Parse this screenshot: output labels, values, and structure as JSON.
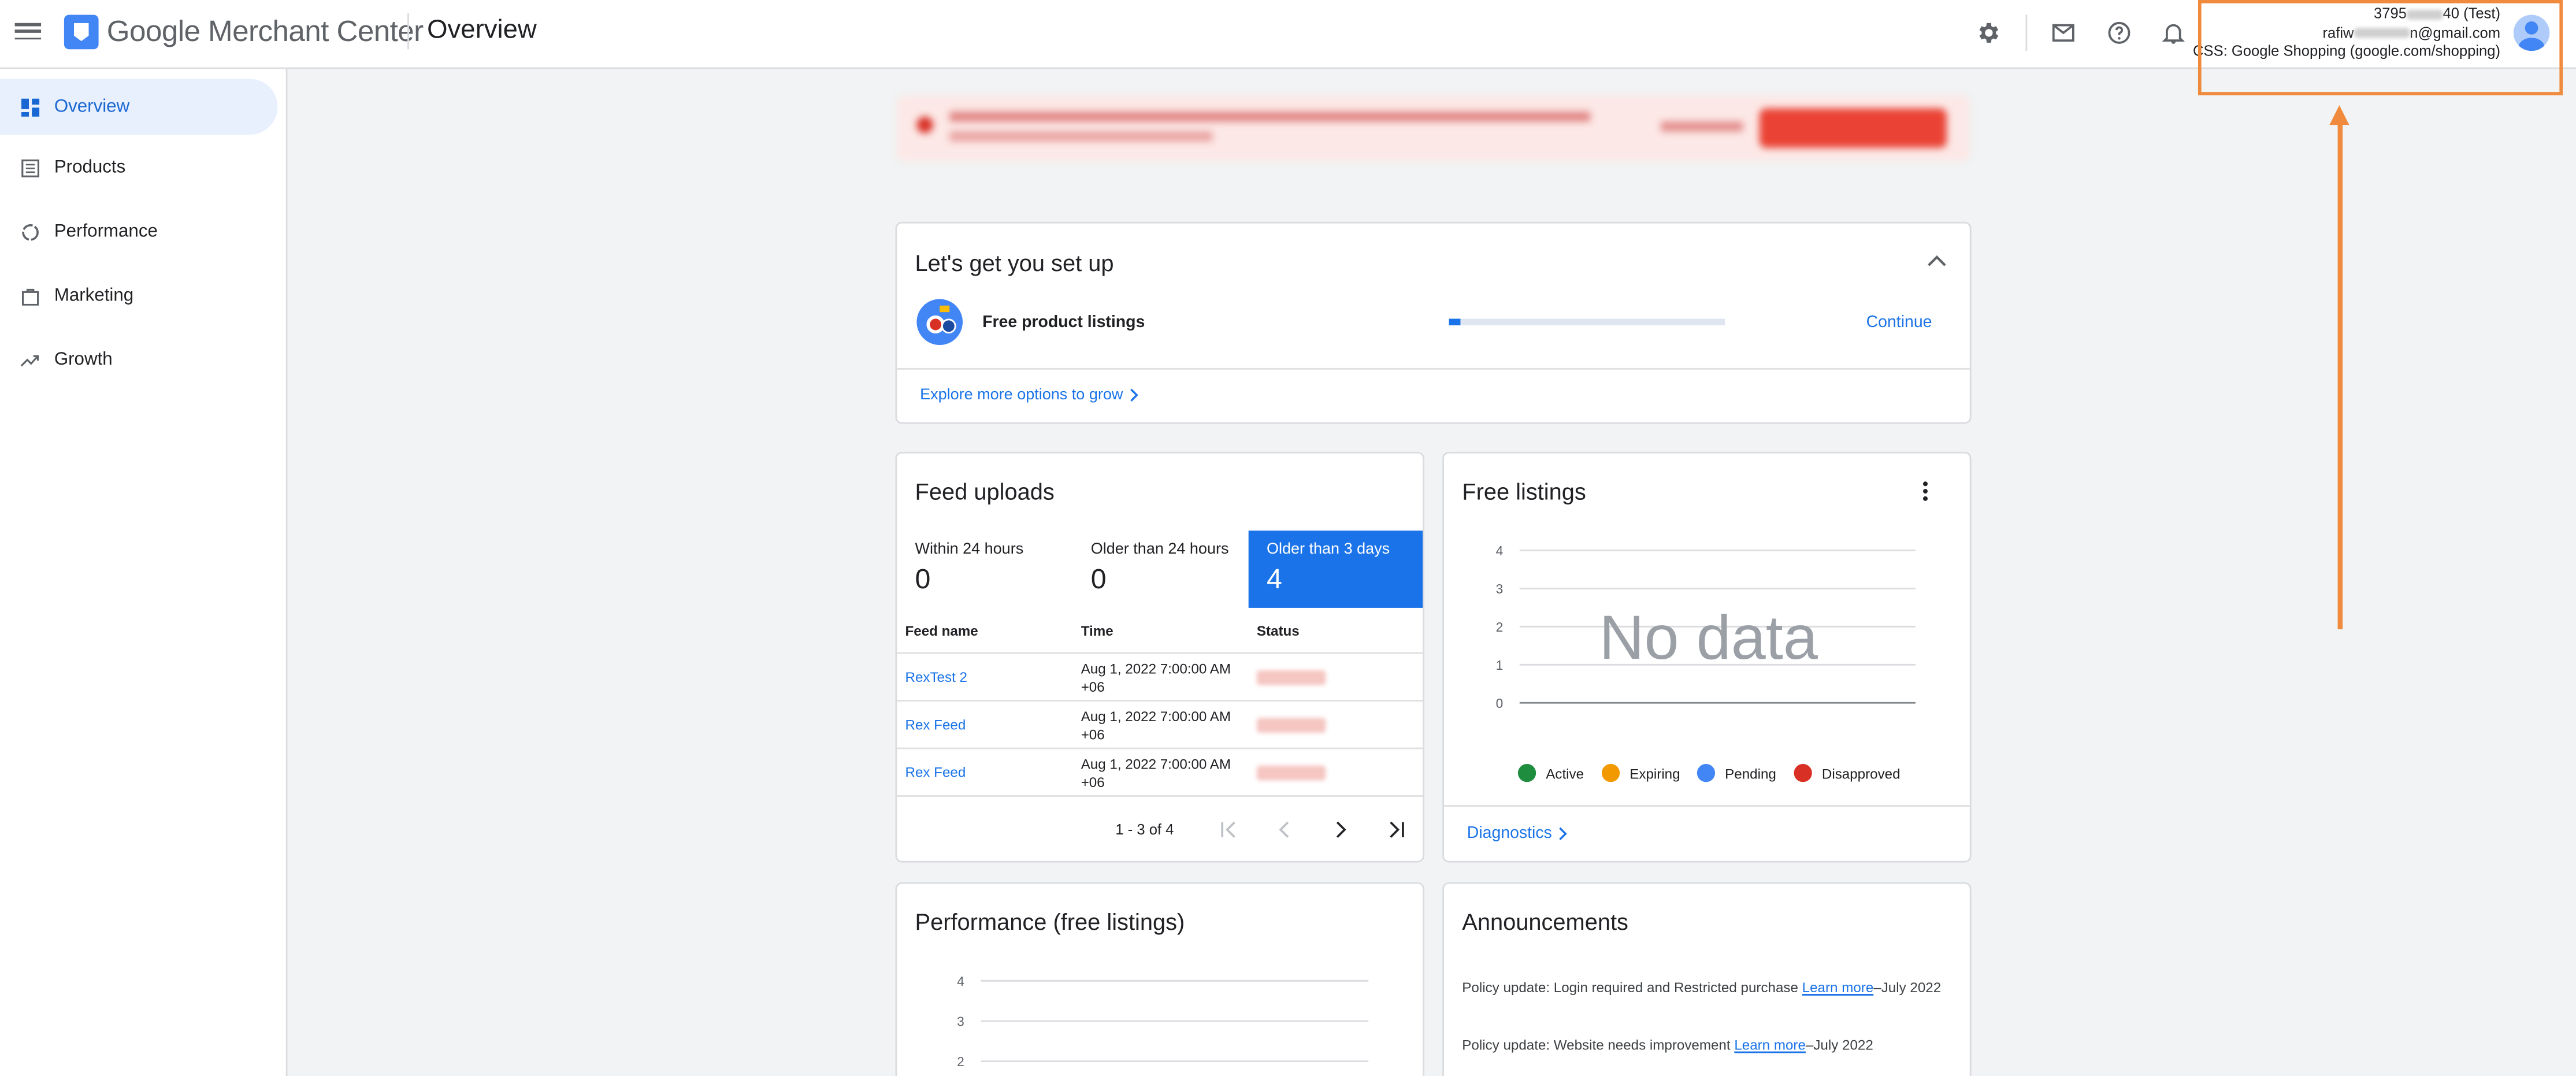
{
  "header": {
    "brand": "Google Merchant Center",
    "page_title": "Overview",
    "account": {
      "id_prefix": "3795",
      "id_suffix": "40 (Test)",
      "email_prefix": "rafiw",
      "email_suffix": "n@gmail.com",
      "css": "CSS: Google Shopping (google.com/shopping)"
    }
  },
  "sidebar": {
    "items": [
      {
        "label": "Overview",
        "icon": "dashboard-icon"
      },
      {
        "label": "Products",
        "icon": "list-icon"
      },
      {
        "label": "Performance",
        "icon": "donut-chart-icon"
      },
      {
        "label": "Marketing",
        "icon": "shopping-bag-icon"
      },
      {
        "label": "Growth",
        "icon": "trending-up-icon"
      }
    ]
  },
  "setup": {
    "title": "Let's get you set up",
    "item_label": "Free product listings",
    "progress": 0.04,
    "continue_label": "Continue",
    "explore_label": "Explore more options to grow"
  },
  "feed_uploads": {
    "title": "Feed uploads",
    "tabs": [
      {
        "label": "Within 24 hours",
        "count": "0"
      },
      {
        "label": "Older than 24 hours",
        "count": "0"
      },
      {
        "label": "Older than 3 days",
        "count": "4"
      }
    ],
    "columns": [
      "Feed name",
      "Time",
      "Status"
    ],
    "rows": [
      {
        "name": "RexTest 2",
        "time": "Aug 1, 2022 7:00:00 AM",
        "tz": "+06"
      },
      {
        "name": "Rex Feed",
        "time": "Aug 1, 2022 7:00:00 AM",
        "tz": "+06"
      },
      {
        "name": "Rex Feed",
        "time": "Aug 1, 2022 7:00:00 AM",
        "tz": "+06"
      }
    ],
    "pagination": "1 - 3 of 4"
  },
  "free_listings": {
    "title": "Free listings",
    "no_data": "No data",
    "y_ticks": [
      "4",
      "3",
      "2",
      "1",
      "0"
    ],
    "legend": [
      {
        "label": "Active",
        "color": "#1e8e3e"
      },
      {
        "label": "Expiring",
        "color": "#f29900"
      },
      {
        "label": "Pending",
        "color": "#4285f4"
      },
      {
        "label": "Disapproved",
        "color": "#d93025"
      }
    ],
    "diagnostics_label": "Diagnostics"
  },
  "performance": {
    "title": "Performance (free listings)",
    "y_ticks": [
      "4",
      "3",
      "2"
    ]
  },
  "announcements": {
    "title": "Announcements",
    "items": [
      {
        "text": "Policy update: Login required and Restricted purchase ",
        "link": "Learn more",
        "date": "–July 2022"
      },
      {
        "text": "Policy update: Website needs improvement ",
        "link": "Learn more",
        "date": "–July 2022"
      }
    ]
  },
  "colors": {
    "accent": "#1a73e8",
    "highlight": "#f08a3c"
  }
}
